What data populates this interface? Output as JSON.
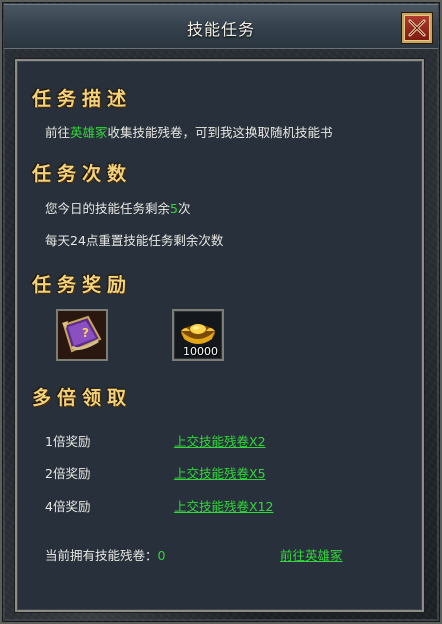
{
  "window": {
    "title": "技能任务"
  },
  "description": {
    "heading": "任务描述",
    "prefix": "前往",
    "location": "英雄冢",
    "suffix": "收集技能残卷，可到我这换取随机技能书"
  },
  "count": {
    "heading": "任务次数",
    "remaining_prefix": "您今日的技能任务剩余",
    "remaining_value": "5",
    "remaining_suffix": "次",
    "reset_note": "每天24点重置技能任务剩余次数"
  },
  "rewards": {
    "heading": "任务奖励",
    "items": [
      {
        "icon": "skill-scroll-icon",
        "count": ""
      },
      {
        "icon": "gold-ingot-icon",
        "count": "10000"
      }
    ]
  },
  "multiplier": {
    "heading": "多倍领取",
    "rows": [
      {
        "label": "1倍奖励",
        "action": "上交技能残卷X2"
      },
      {
        "label": "2倍奖励",
        "action": "上交技能残卷X5"
      },
      {
        "label": "4倍奖励",
        "action": "上交技能残卷X12"
      }
    ]
  },
  "footer": {
    "owned_label": "当前拥有技能残卷：",
    "owned_value": "0",
    "goto_link": "前往英雄冢"
  },
  "colors": {
    "heading": "#f3d27c",
    "highlight": "#32d63a",
    "text": "#e7e7e2"
  }
}
